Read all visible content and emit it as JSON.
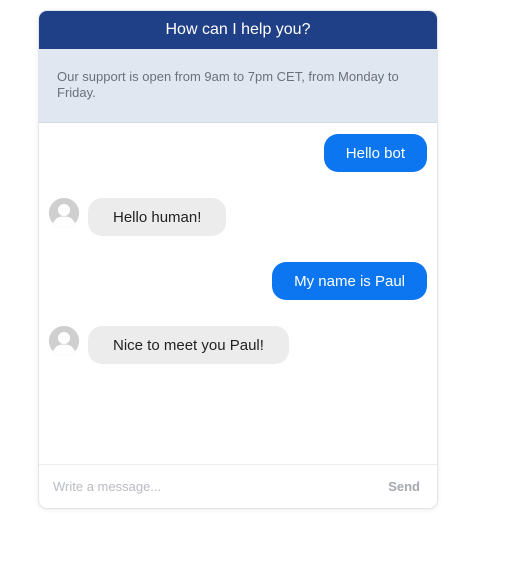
{
  "header": {
    "title": "How can I help you?"
  },
  "notice": {
    "text": "Our support is open from 9am to 7pm CET, from Monday to Friday."
  },
  "messages": [
    {
      "from": "user",
      "text": "Hello bot"
    },
    {
      "from": "bot",
      "text": "Hello human!"
    },
    {
      "from": "user",
      "text": "My name is Paul"
    },
    {
      "from": "bot",
      "text": "Nice to meet you Paul!"
    }
  ],
  "composer": {
    "placeholder": "Write a message...",
    "send_label": "Send"
  },
  "colors": {
    "header_bg": "#1f3f86",
    "user_bubble": "#0b76f0",
    "bot_bubble": "#ececec",
    "notice_bg": "#e1e7f1"
  },
  "icons": {
    "bot_avatar": "user-avatar-icon"
  }
}
